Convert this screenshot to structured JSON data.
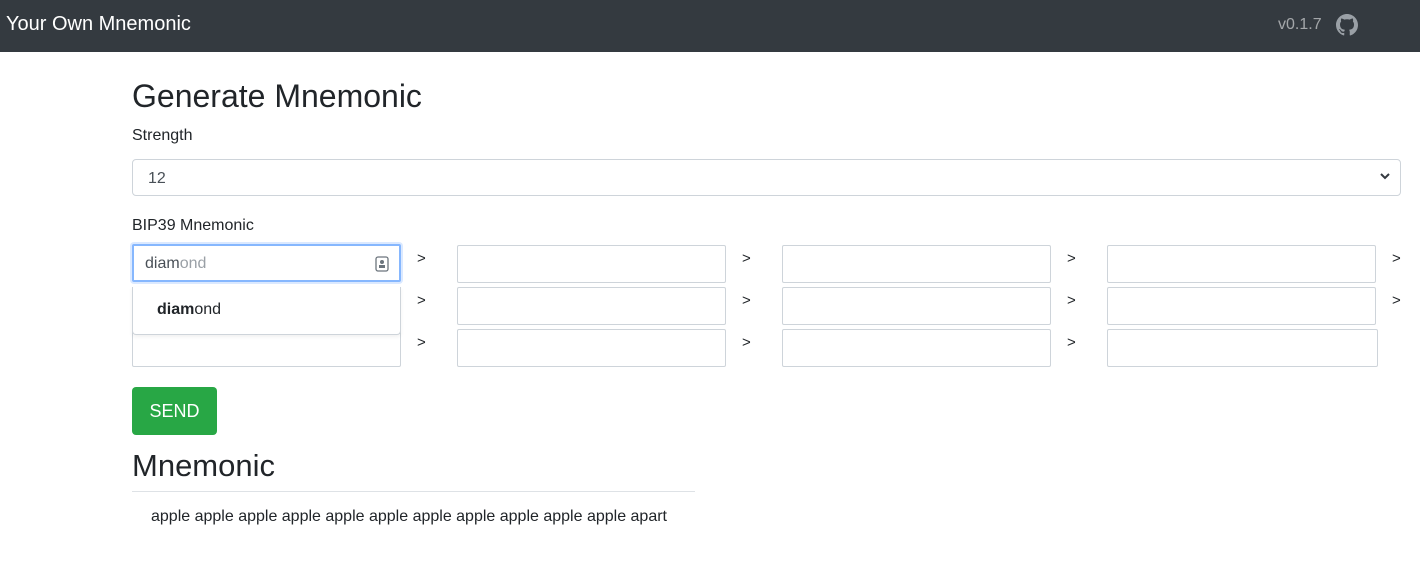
{
  "navbar": {
    "brand": "Your Own Mnemonic",
    "version": "v0.1.7",
    "github_icon": "github-icon"
  },
  "page": {
    "title": "Generate Mnemonic"
  },
  "strength": {
    "label": "Strength",
    "selected": "12"
  },
  "mnemonic_input": {
    "label": "BIP39 Mnemonic",
    "active_word": {
      "typed": "diam",
      "suggestion_rest": "ond"
    },
    "separator": ">",
    "autocomplete": {
      "match": "diam",
      "rest": "ond"
    }
  },
  "send": {
    "label": "SEND"
  },
  "result": {
    "title": "Mnemonic",
    "phrase": "apple apple apple apple apple apple apple apple apple apple apple apart"
  },
  "colors": {
    "navbar": "#343a40",
    "send_button": "#28a745",
    "focus_border": "#86b7fe"
  }
}
